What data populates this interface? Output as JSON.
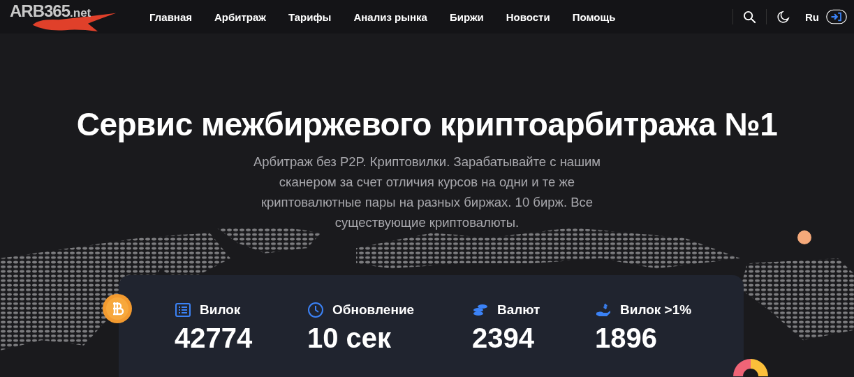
{
  "logo": {
    "text": "ARB365",
    "suffix": ".net"
  },
  "nav": [
    {
      "label": "Главная"
    },
    {
      "label": "Арбитраж"
    },
    {
      "label": "Тарифы"
    },
    {
      "label": "Анализ рынка"
    },
    {
      "label": "Биржи"
    },
    {
      "label": "Новости"
    },
    {
      "label": "Помощь"
    }
  ],
  "language": "Ru",
  "hero": {
    "title": "Сервис межбиржевого криптоарбитража №1",
    "subtitle": "Арбитраж без P2P. Криптовилки. Зарабатывайте с нашим сканером за счет отличия курсов на одни и те же криптовалютные пары на разных биржах. 10 бирж. Все существующие криптовалюты."
  },
  "stats": [
    {
      "kind": "list",
      "label": "Вилок",
      "value": "42774"
    },
    {
      "kind": "clock",
      "label": "Обновление",
      "value": "10 сек"
    },
    {
      "kind": "coins",
      "label": "Валют",
      "value": "2394"
    },
    {
      "kind": "hand",
      "label": "Вилок >1%",
      "value": "1896"
    }
  ]
}
